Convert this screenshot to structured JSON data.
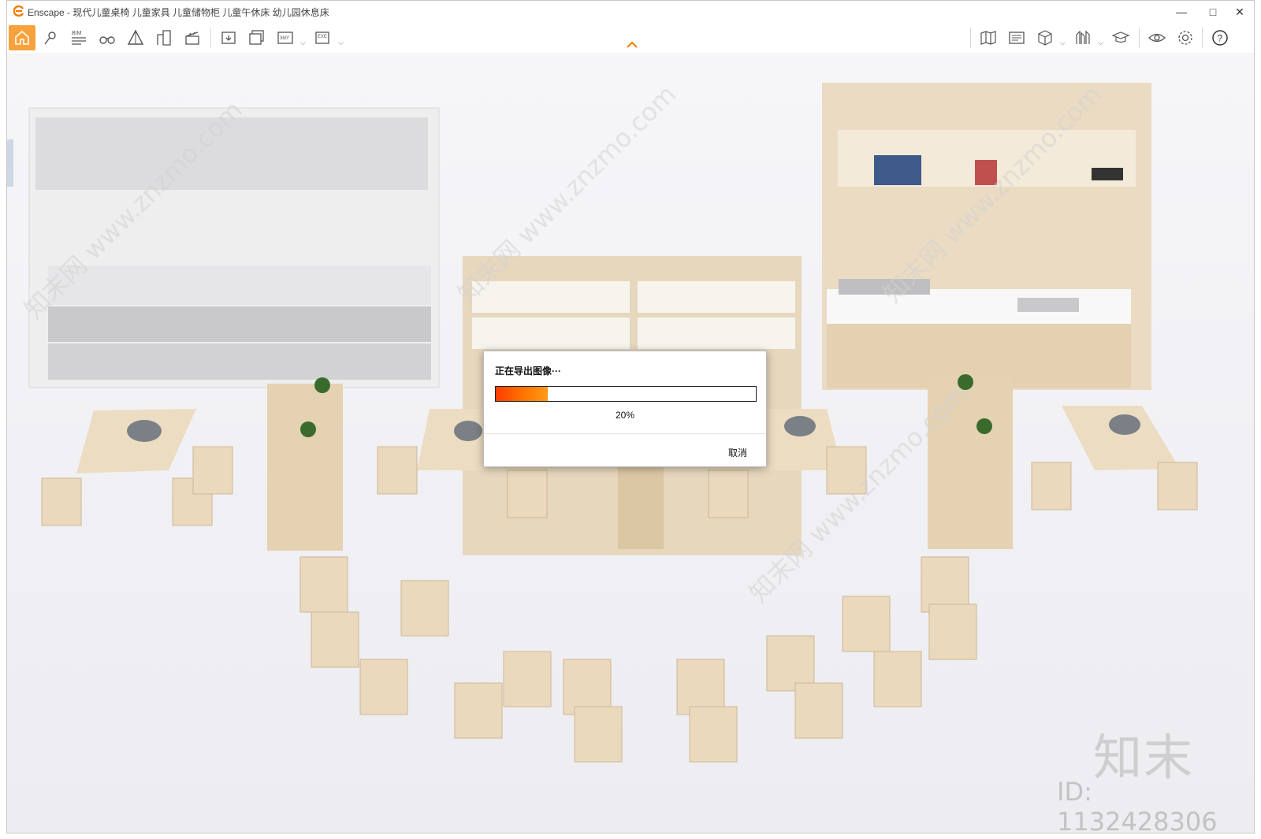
{
  "window": {
    "title": "Enscape - 现代儿童桌椅 儿童家具 儿童储物柜 儿童午休床 幼儿园休息床",
    "controls": [
      "minimize-icon",
      "maximize-icon",
      "close-icon"
    ]
  },
  "toolbar": {
    "left_icons": [
      "home-icon",
      "location-pin-icon",
      "bim-icon",
      "binoculars-icon",
      "triangle-view-icon",
      "building-icon",
      "clapper-icon",
      "screenshot-icon",
      "batch-render-icon",
      "panorama-360-icon",
      "export-exe-icon"
    ],
    "bim_label": "BIM",
    "pano_label": "360°",
    "exe_label": "EXE",
    "right_icons": [
      "map-icon",
      "asset-library-icon",
      "cube-icon",
      "material-icon",
      "grad-cap-icon",
      "eye-icon",
      "settings-icon",
      "help-icon"
    ],
    "accent": "#f7a23b"
  },
  "dialog": {
    "title": "正在导出图像···",
    "progress_label": "20%",
    "progress_fraction": 0.2,
    "cancel_label": "取消"
  },
  "watermark": {
    "brand": "知末",
    "id_text": "ID: 1132428306",
    "diagonal": "知末网 www.znzmo.com"
  }
}
